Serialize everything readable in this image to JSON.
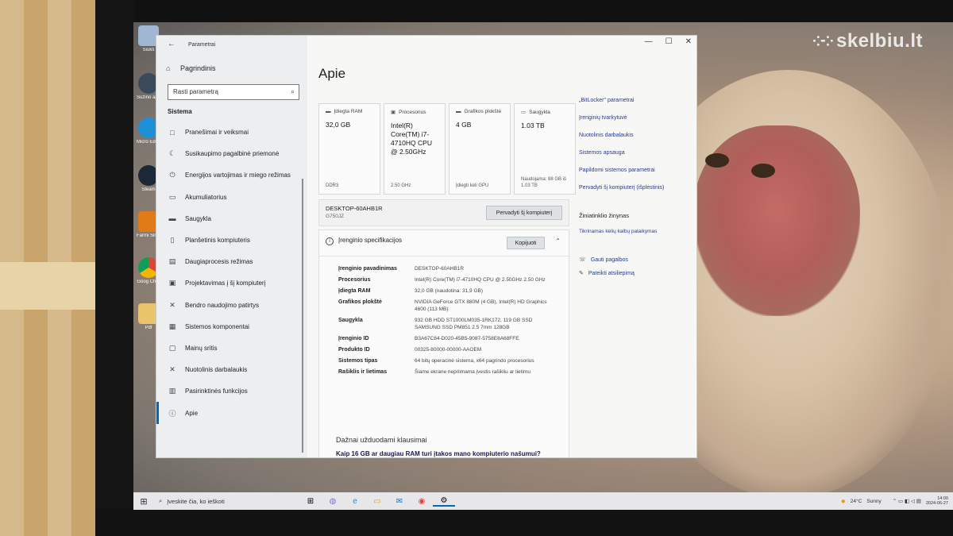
{
  "watermark": {
    "text": "skelbiu.lt"
  },
  "desktop_icons": [
    {
      "name": "recycle-bin",
      "label": "Šiukš"
    },
    {
      "name": "info",
      "label": "Sužino apie š"
    },
    {
      "name": "edge",
      "label": "Micro Edge"
    },
    {
      "name": "steam",
      "label": "Steam"
    },
    {
      "name": "farming",
      "label": "Farmi Simulat"
    },
    {
      "name": "chrome",
      "label": "Goog Chro"
    },
    {
      "name": "folder",
      "label": "Pdf"
    }
  ],
  "window": {
    "title": "Parametrai",
    "controls": {
      "minimize": "—",
      "maximize": "☐",
      "close": "✕"
    }
  },
  "sidebar": {
    "home": "Pagrindinis",
    "search_placeholder": "Rasti parametrą",
    "section": "Sistema",
    "items": [
      {
        "label": "Pranešimai ir veiksmai",
        "icon": "□"
      },
      {
        "label": "Susikaupimo pagalbinė priemonė",
        "icon": "☾"
      },
      {
        "label": "Energijos vartojimas ir miego režimas",
        "icon": "⏻"
      },
      {
        "label": "Akumuliatorius",
        "icon": "▭"
      },
      {
        "label": "Saugykla",
        "icon": "▬"
      },
      {
        "label": "Planšetinis kompiuteris",
        "icon": "▯"
      },
      {
        "label": "Daugiaprocesis režimas",
        "icon": "▤"
      },
      {
        "label": "Projektavimas į šį kompiuterį",
        "icon": "▣"
      },
      {
        "label": "Bendro naudojimo patirtys",
        "icon": "✕"
      },
      {
        "label": "Sistemos komponentai",
        "icon": "▦"
      },
      {
        "label": "Mainų sritis",
        "icon": "▢"
      },
      {
        "label": "Nuotolinis darbalaukis",
        "icon": "✕"
      },
      {
        "label": "Pasirinktinės funkcijos",
        "icon": "▥"
      },
      {
        "label": "Apie",
        "icon": "ⓘ"
      }
    ]
  },
  "main": {
    "title": "Apie",
    "tiles": [
      {
        "head": "Įdiegta RAM",
        "icon": "▬",
        "value": "32,0 GB",
        "foot": "DDR3"
      },
      {
        "head": "Procesorius",
        "icon": "▣",
        "value": "Intel(R) Core(TM) i7-4710HQ CPU @ 2.50GHz",
        "foot": "2.50 GHz"
      },
      {
        "head": "Grafikos plokštė",
        "icon": "▬",
        "value": "4 GB",
        "foot": "Įdiegti keli GPU"
      },
      {
        "head": "Saugykla",
        "icon": "▭",
        "value": "1.03 TB",
        "foot": "Naudojama: 88 GB iš 1.03 TB"
      }
    ],
    "device_name": "DESKTOP-60AHB1R",
    "device_model": "G750JZ",
    "rename_button": "Pervadyti šį kompiuterį",
    "spec": {
      "title": "Įrenginio specifikacijos",
      "copy_button": "Kopijuoti",
      "rows": [
        {
          "k": "Įrenginio pavadinimas",
          "v": "DESKTOP-60AHB1R"
        },
        {
          "k": "Procesorius",
          "v": "Intel(R) Core(TM) i7-4710HQ CPU @ 2.50GHz 2.50 GHz"
        },
        {
          "k": "Įdiegta RAM",
          "v": "32,0 GB (naudotina: 31,9 GB)"
        },
        {
          "k": "Grafikos plokštė",
          "v": "NVIDIA GeForce GTX 880M (4 GB), Intel(R) HD Graphics 4600 (113 MB)"
        },
        {
          "k": "Saugykla",
          "v": "932 GB HDD ST1000LM035-1RK172, 119 GB SSD SAMSUNG SSD PM851 2.5 7mm 128GB"
        },
        {
          "k": "Įrenginio ID",
          "v": "B3A67C84-D020-45B5-9087-5758E8A68FFE"
        },
        {
          "k": "Produkto ID",
          "v": "00325-80000-00000-AAOEM"
        },
        {
          "k": "Sistemos tipas",
          "v": "64 bitų operacinė sistema, x64 pagrindo procesorius"
        },
        {
          "k": "Rašiklis ir lietimas",
          "v": "Šiame ekrane nepriimama įvestis rašikliu ar lietimu"
        }
      ]
    },
    "faq_title": "Dažnai užduodami klausimai",
    "faq_link": "Kaip 16 GB ar daugiau RAM turi įtakos mano kompiuterio našumui?",
    "related_links": [
      "„BitLocker\" parametrai",
      "Įrenginių tvarkytuvė",
      "Nuotolinis darbalaukis",
      "Sistemos apsauga",
      "Papildomi sistemos parametrai",
      "Pervadyti šį kompiuterį (išplėstinis)"
    ],
    "help_title": "Žiniatinklio žinynas",
    "help_link": "Tikrinamas kelių kalbų palaikymas",
    "help_items": [
      {
        "icon": "☏",
        "label": "Gauti pagalbos"
      },
      {
        "icon": "✎",
        "label": "Pateikti atsiliepimą"
      }
    ]
  },
  "taskbar": {
    "search_placeholder": "Įveskite čia, ko ieškoti",
    "apps": [
      "⊞",
      "◍",
      "e",
      "▭",
      "✉",
      "◉",
      "⚙"
    ],
    "weather_temp": "24°C",
    "weather_text": "Sunny",
    "tray_icons": "⌃ ▭ ◧ ◁ ▤",
    "time": "14:00",
    "date": "2024-06-27"
  }
}
